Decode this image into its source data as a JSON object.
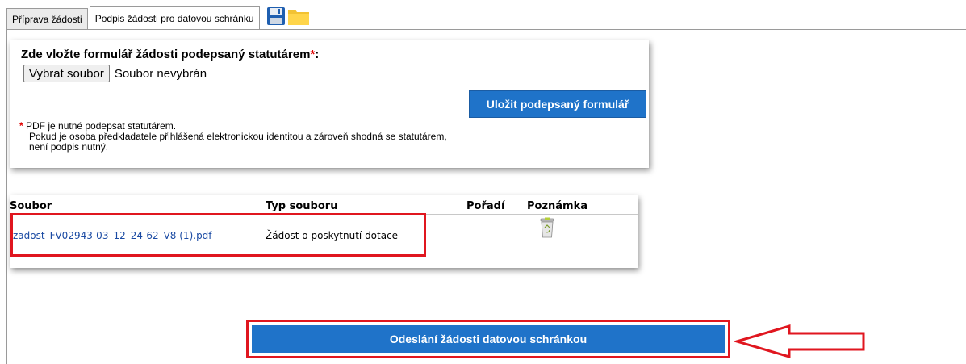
{
  "tabs": [
    {
      "label": "Příprava žádosti",
      "active": false
    },
    {
      "label": "Podpis žádosti pro datovou schránku",
      "active": true
    }
  ],
  "tab_icons": [
    "save-icon",
    "folder-icon"
  ],
  "upload": {
    "title": "Zde vložte formulář žádosti podepsaný statutárem",
    "required_mark": "*",
    "colon": ":",
    "choose_button": "Vybrat soubor",
    "no_file_text": "Soubor nevybrán",
    "save_button": "Uložit podepsaný formulář",
    "note_star": "*",
    "note_line1": "PDF je nutné podepsat statutárem.",
    "note_line2": "Pokud je osoba předkladatele přihlášená elektronickou identitou a zároveň shodná se statutárem,",
    "note_line3": "není podpis nutný."
  },
  "table": {
    "headers": {
      "file": "Soubor",
      "type": "Typ souboru",
      "order": "Pořadí",
      "note": "Poznámka"
    },
    "rows": [
      {
        "file": "zadost_FV02943-03_12_24-62_V8 (1).pdf",
        "type": "Žádost o poskytnutí dotace",
        "order": "",
        "action_icon": "recycle-bin-icon"
      }
    ]
  },
  "send_button": "Odeslání žádosti datovou schránkou",
  "colors": {
    "accent_blue": "#1f73c9",
    "highlight_red": "#e0161f",
    "link_blue": "#1a4aa3"
  }
}
